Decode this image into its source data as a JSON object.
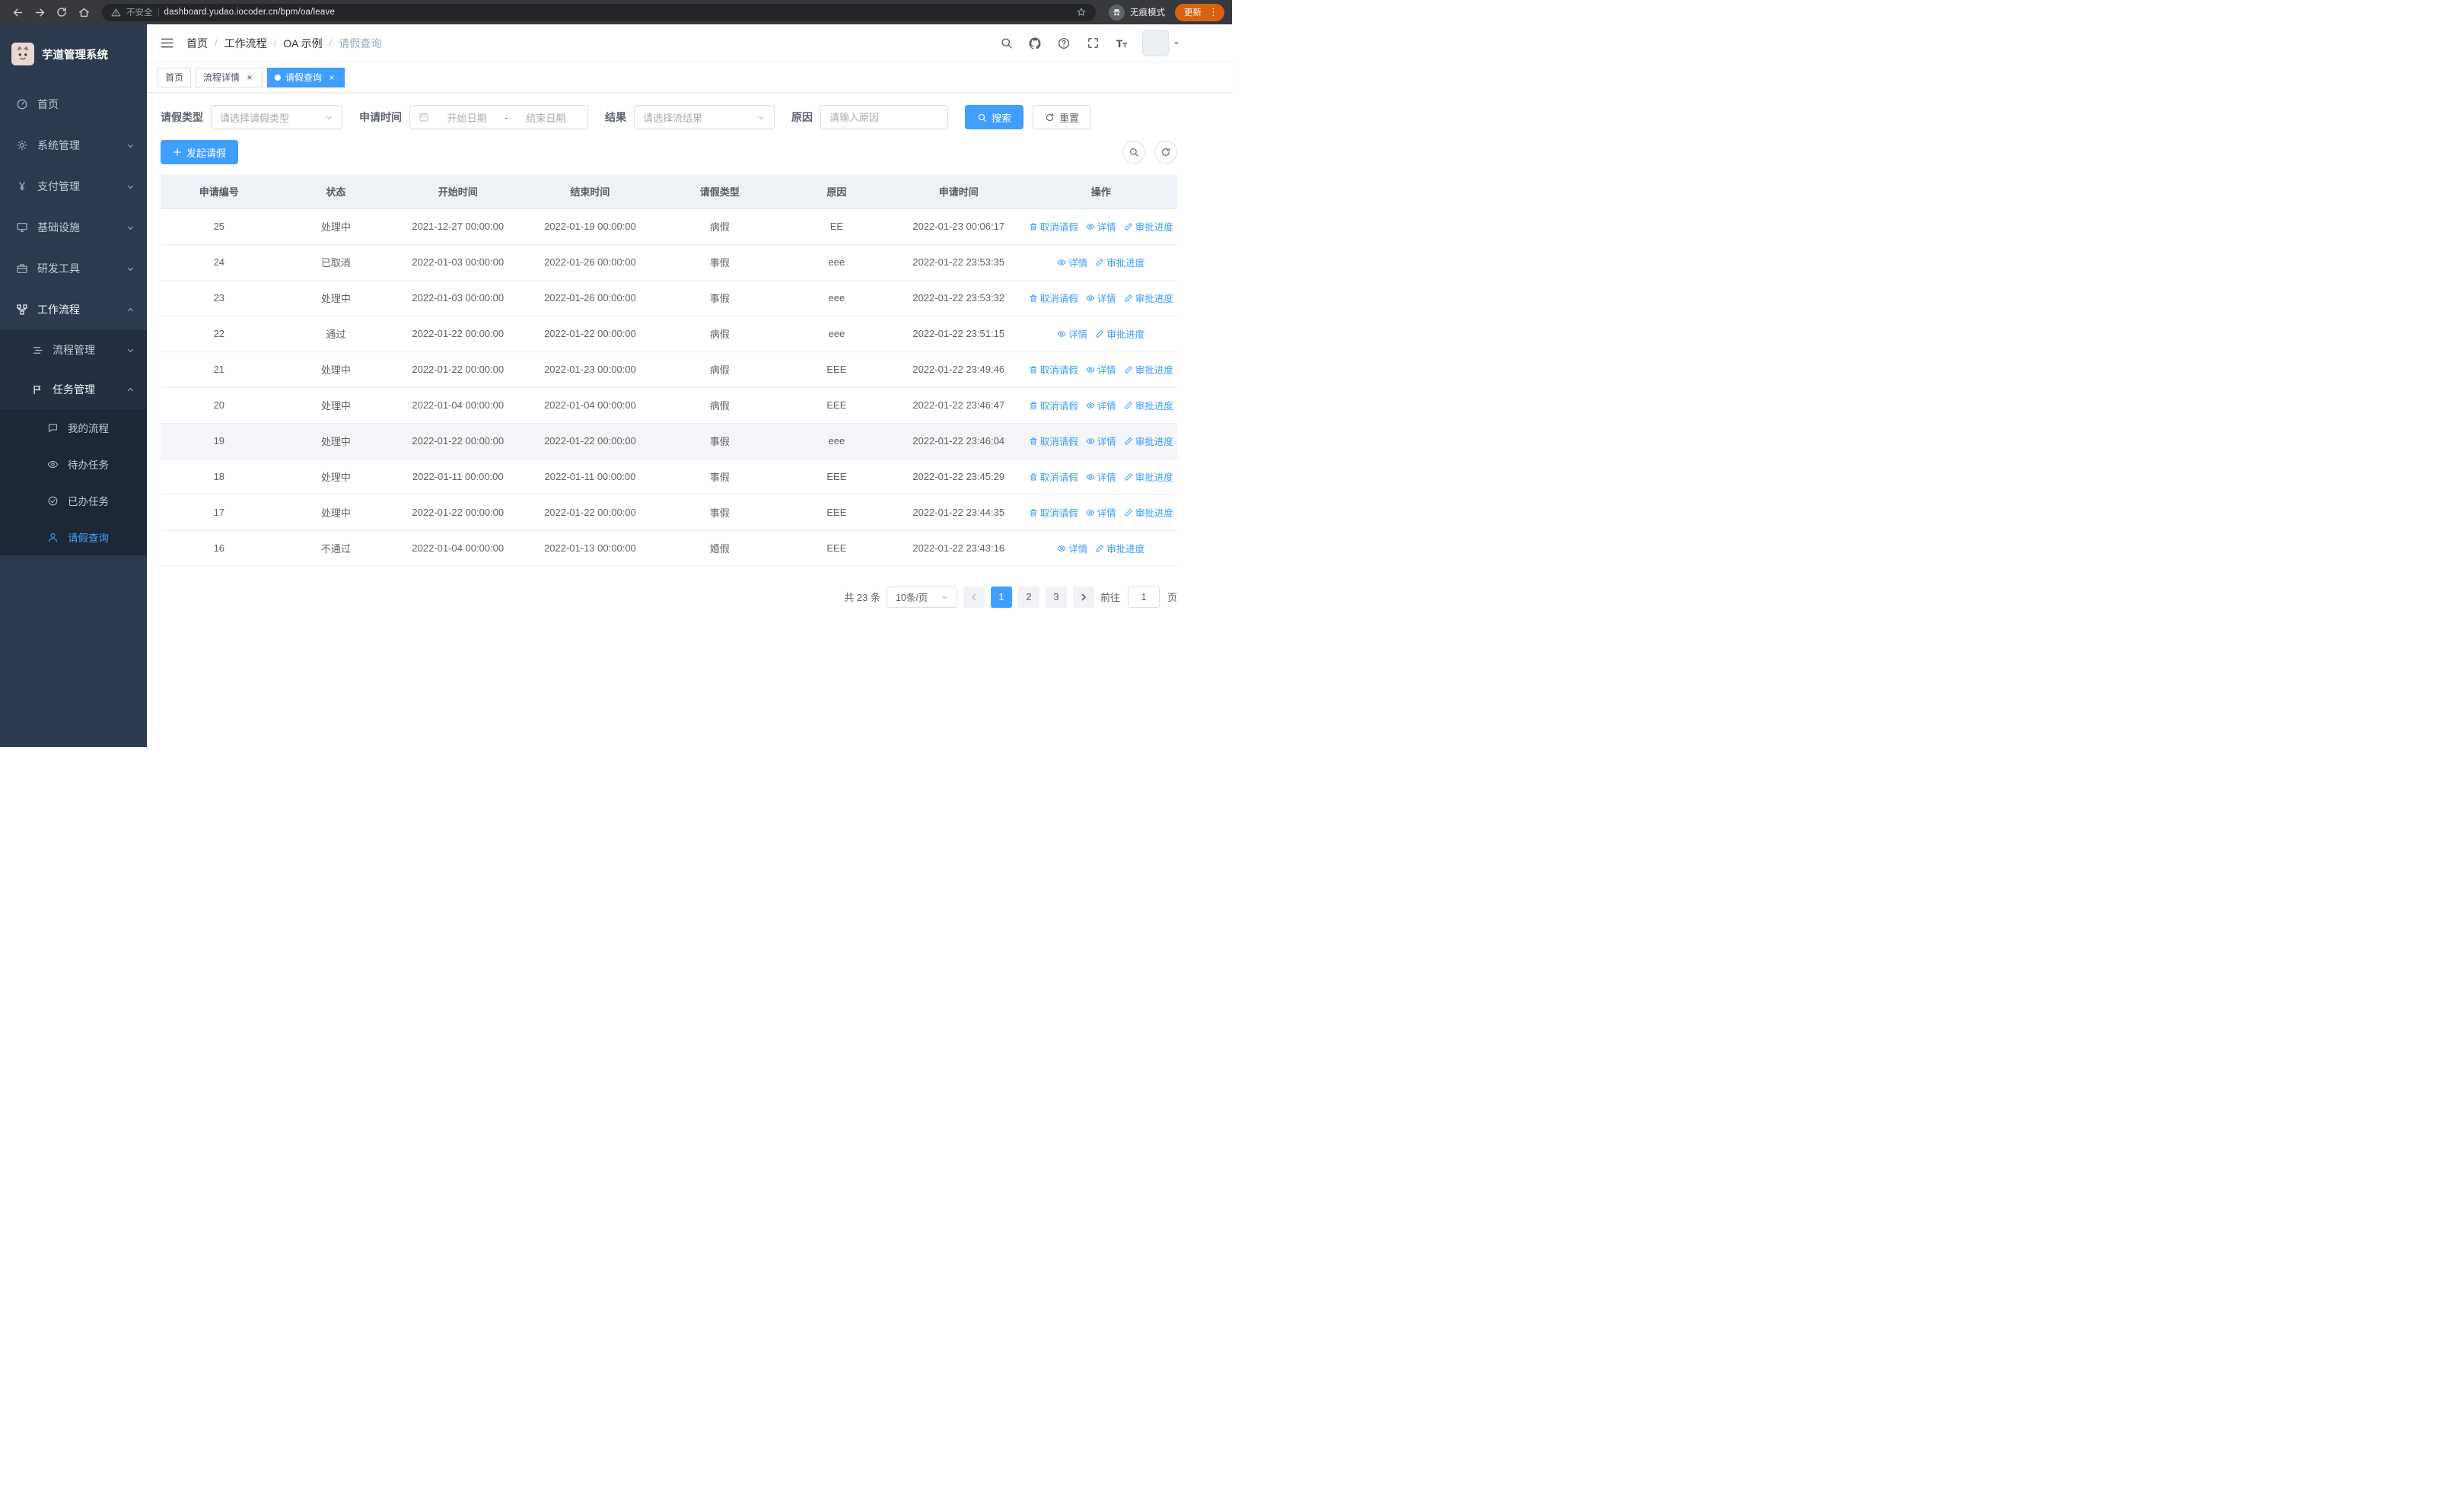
{
  "browser": {
    "security_label": "不安全",
    "url": "dashboard.yudao.iocoder.cn/bpm/oa/leave",
    "incognito_label": "无痕模式",
    "update_label": "更新"
  },
  "sidebar": {
    "app_title": "芋道管理系统",
    "items": [
      {
        "label": "首页",
        "icon": "dashboard-icon"
      },
      {
        "label": "系统管理",
        "icon": "gear-icon"
      },
      {
        "label": "支付管理",
        "icon": "yen-icon"
      },
      {
        "label": "基础设施",
        "icon": "monitor-icon"
      },
      {
        "label": "研发工具",
        "icon": "briefcase-icon"
      },
      {
        "label": "工作流程",
        "icon": "workflow-icon",
        "expanded": true,
        "children": [
          {
            "label": "流程管理",
            "icon": "stream-icon"
          },
          {
            "label": "任务管理",
            "icon": "task-icon",
            "expanded": true,
            "children": [
              {
                "label": "我的流程",
                "icon": "chat-icon"
              },
              {
                "label": "待办任务",
                "icon": "eye-icon"
              },
              {
                "label": "已办任务",
                "icon": "check-circle-icon"
              },
              {
                "label": "请假查询",
                "icon": "user-icon",
                "active": true
              }
            ]
          }
        ]
      }
    ]
  },
  "breadcrumb": {
    "separator": "/",
    "items": [
      "首页",
      "工作流程",
      "OA 示例",
      "请假查询"
    ]
  },
  "tabs": [
    {
      "label": "首页"
    },
    {
      "label": "流程详情",
      "closable": true
    },
    {
      "label": "请假查询",
      "closable": true,
      "active": true
    }
  ],
  "filters": {
    "leave_type_label": "请假类型",
    "leave_type_placeholder": "请选择请假类型",
    "apply_time_label": "申请时间",
    "start_date_placeholder": "开始日期",
    "range_separator": "-",
    "end_date_placeholder": "结束日期",
    "result_label": "结果",
    "result_placeholder": "请选择流结果",
    "reason_label": "原因",
    "reason_placeholder": "请输入原因",
    "search_label": "搜索",
    "reset_label": "重置"
  },
  "toolbar": {
    "create_label": "发起请假"
  },
  "table": {
    "columns": [
      "申请编号",
      "状态",
      "开始时间",
      "结束时间",
      "请假类型",
      "原因",
      "申请时间",
      "操作"
    ],
    "ops_labels": {
      "cancel": "取消请假",
      "detail": "详情",
      "progress": "审批进度"
    },
    "rows": [
      {
        "id": "25",
        "status": "处理中",
        "start": "2021-12-27 00:00:00",
        "end": "2022-01-19 00:00:00",
        "type": "病假",
        "reason": "EE",
        "applied": "2022-01-23 00:06:17",
        "ops": [
          "cancel",
          "detail",
          "progress"
        ]
      },
      {
        "id": "24",
        "status": "已取消",
        "start": "2022-01-03 00:00:00",
        "end": "2022-01-26 00:00:00",
        "type": "事假",
        "reason": "eee",
        "applied": "2022-01-22 23:53:35",
        "ops": [
          "detail",
          "progress"
        ]
      },
      {
        "id": "23",
        "status": "处理中",
        "start": "2022-01-03 00:00:00",
        "end": "2022-01-26 00:00:00",
        "type": "事假",
        "reason": "eee",
        "applied": "2022-01-22 23:53:32",
        "ops": [
          "cancel",
          "detail",
          "progress"
        ]
      },
      {
        "id": "22",
        "status": "通过",
        "start": "2022-01-22 00:00:00",
        "end": "2022-01-22 00:00:00",
        "type": "病假",
        "reason": "eee",
        "applied": "2022-01-22 23:51:15",
        "ops": [
          "detail",
          "progress"
        ]
      },
      {
        "id": "21",
        "status": "处理中",
        "start": "2022-01-22 00:00:00",
        "end": "2022-01-23 00:00:00",
        "type": "病假",
        "reason": "EEE",
        "applied": "2022-01-22 23:49:46",
        "ops": [
          "cancel",
          "detail",
          "progress"
        ]
      },
      {
        "id": "20",
        "status": "处理中",
        "start": "2022-01-04 00:00:00",
        "end": "2022-01-04 00:00:00",
        "type": "病假",
        "reason": "EEE",
        "applied": "2022-01-22 23:46:47",
        "ops": [
          "cancel",
          "detail",
          "progress"
        ]
      },
      {
        "id": "19",
        "status": "处理中",
        "start": "2022-01-22 00:00:00",
        "end": "2022-01-22 00:00:00",
        "type": "事假",
        "reason": "eee",
        "applied": "2022-01-22 23:46:04",
        "ops": [
          "cancel",
          "detail",
          "progress"
        ],
        "highlight": true
      },
      {
        "id": "18",
        "status": "处理中",
        "start": "2022-01-11 00:00:00",
        "end": "2022-01-11 00:00:00",
        "type": "事假",
        "reason": "EEE",
        "applied": "2022-01-22 23:45:29",
        "ops": [
          "cancel",
          "detail",
          "progress"
        ]
      },
      {
        "id": "17",
        "status": "处理中",
        "start": "2022-01-22 00:00:00",
        "end": "2022-01-22 00:00:00",
        "type": "事假",
        "reason": "EEE",
        "applied": "2022-01-22 23:44:35",
        "ops": [
          "cancel",
          "detail",
          "progress"
        ]
      },
      {
        "id": "16",
        "status": "不通过",
        "start": "2022-01-04 00:00:00",
        "end": "2022-01-13 00:00:00",
        "type": "婚假",
        "reason": "EEE",
        "applied": "2022-01-22 23:43:16",
        "ops": [
          "detail",
          "progress"
        ]
      }
    ]
  },
  "pagination": {
    "total_label": "共 23 条",
    "page_size": "10条/页",
    "pages": [
      "1",
      "2",
      "3"
    ],
    "active_page": "1",
    "goto_label": "前往",
    "goto_value": "1",
    "page_unit": "页"
  },
  "colors": {
    "accent": "#409eff",
    "sidebar_bg": "#2d3a4d",
    "update_chip": "#d96110"
  }
}
